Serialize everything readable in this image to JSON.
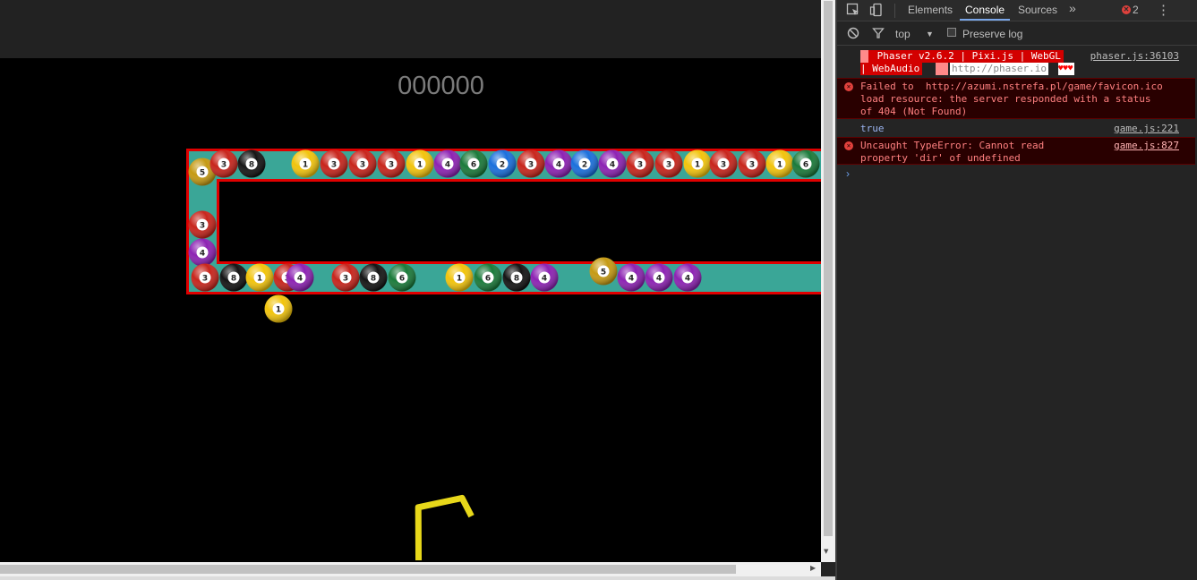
{
  "game": {
    "score": "000000",
    "colors": {
      "track_fill": "#3aa697",
      "track_border": "#e00000",
      "background": "#000000",
      "launcher": "#e8d81a"
    },
    "ball_palette": {
      "1": "#f2c40c",
      "2": "#1a6fdc",
      "3": "#c8251c",
      "4": "#8d22b3",
      "5": "#c59a13",
      "6": "#1a7a3a",
      "8": "#141414"
    },
    "top_row_balls": [
      "5",
      "3",
      "8",
      "1",
      "3",
      "3",
      "3",
      "1",
      "4",
      "6",
      "2",
      "3",
      "4",
      "2",
      "4",
      "3",
      "3",
      "1",
      "3",
      "3",
      "1",
      "6"
    ],
    "left_column_balls": [
      "3",
      "4"
    ],
    "bottom_row_balls": [
      "3",
      "8",
      "1",
      "4",
      "3",
      "3",
      "8",
      "6",
      "1",
      "6",
      "8",
      "4",
      "5",
      "4",
      "4",
      "4"
    ],
    "launcher_ball": "1"
  },
  "devtools": {
    "tabs": [
      "Elements",
      "Console",
      "Sources"
    ],
    "active_tab": "Console",
    "more_tabs_icon": "»",
    "error_count": "2",
    "menu_icon": "⋮",
    "toolbar": {
      "context": "top",
      "preserve_log": "Preserve log"
    },
    "messages": [
      {
        "type": "log",
        "line1": " Phaser v2.6.2 | Pixi.js | WebGL",
        "line2": "| WebAudio",
        "link": "http://phaser.io",
        "hearts": "♥♥♥",
        "source": "phaser.js:36103"
      },
      {
        "type": "error",
        "line1": "Failed to  http://azumi.nstrefa.pl/game/favicon.ico",
        "line2": "load resource: the server responded with a status",
        "line3": "of 404 (Not Found)",
        "source": ""
      },
      {
        "type": "log",
        "line1": "true",
        "source": "game.js:221"
      },
      {
        "type": "error",
        "line1": "Uncaught TypeError: Cannot read",
        "line2": "property 'dir' of undefined",
        "source": "game.js:827"
      }
    ],
    "prompt": "›"
  }
}
